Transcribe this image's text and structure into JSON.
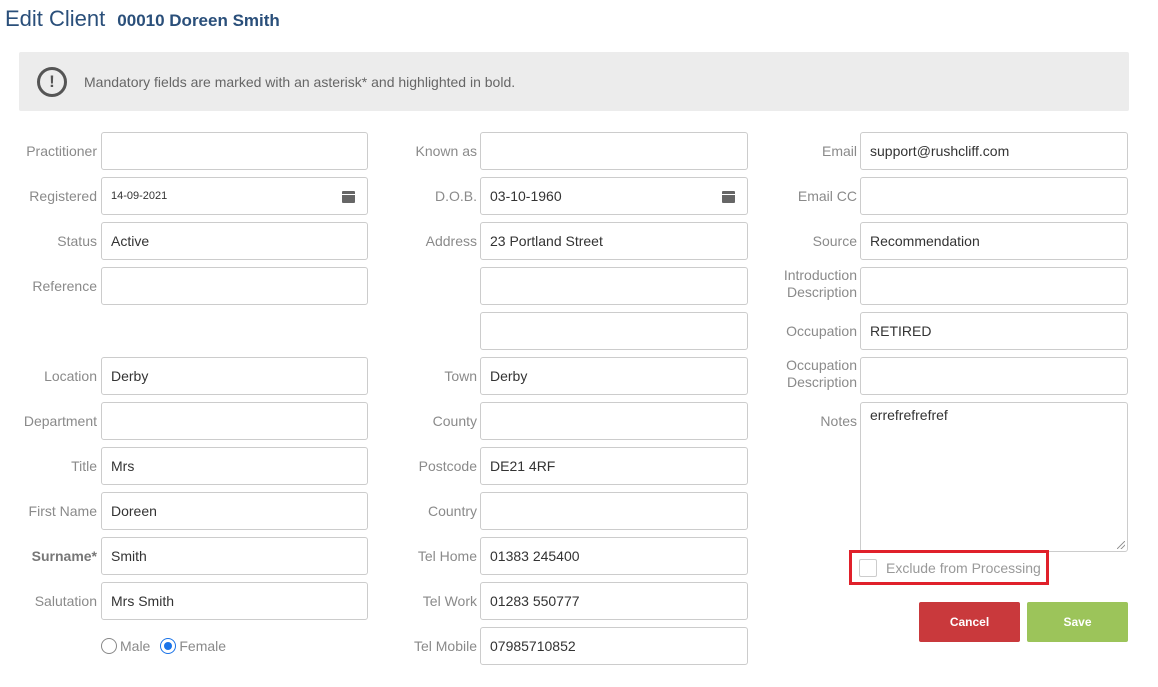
{
  "header": {
    "title": "Edit Client",
    "client": "00010 Doreen Smith"
  },
  "notice": {
    "icon": "info-icon",
    "text": "Mandatory fields are marked with an asterisk* and highlighted in bold."
  },
  "col1": {
    "practitioner": {
      "label": "Practitioner",
      "value": ""
    },
    "registered": {
      "label": "Registered",
      "value": "14-09-2021"
    },
    "status": {
      "label": "Status",
      "value": "Active"
    },
    "reference": {
      "label": "Reference",
      "value": ""
    },
    "location": {
      "label": "Location",
      "value": "Derby"
    },
    "department": {
      "label": "Department",
      "value": ""
    },
    "title": {
      "label": "Title",
      "value": "Mrs"
    },
    "first_name": {
      "label": "First Name",
      "value": "Doreen"
    },
    "surname": {
      "label": "Surname*",
      "value": "Smith"
    },
    "salutation": {
      "label": "Salutation",
      "value": "Mrs Smith"
    },
    "gender": {
      "male": "Male",
      "female": "Female",
      "selected": "Female"
    }
  },
  "col2": {
    "known_as": {
      "label": "Known as",
      "value": ""
    },
    "dob": {
      "label": "D.O.B.",
      "value": "03-10-1960"
    },
    "address": {
      "label": "Address",
      "line1": "23 Portland Street",
      "line2": "",
      "line3": ""
    },
    "town": {
      "label": "Town",
      "value": "Derby"
    },
    "county": {
      "label": "County",
      "value": ""
    },
    "postcode": {
      "label": "Postcode",
      "value": "DE21 4RF"
    },
    "country": {
      "label": "Country",
      "value": ""
    },
    "tel_home": {
      "label": "Tel Home",
      "value": "01383 245400"
    },
    "tel_work": {
      "label": "Tel Work",
      "value": "01283 550777"
    },
    "tel_mobile": {
      "label": "Tel Mobile",
      "value": "07985710852"
    }
  },
  "col3": {
    "email": {
      "label": "Email",
      "value": "support@rushcliff.com"
    },
    "email_cc": {
      "label": "Email CC",
      "value": ""
    },
    "source": {
      "label": "Source",
      "value": "Recommendation"
    },
    "intro_desc": {
      "label1": "Introduction",
      "label2": "Description",
      "value": ""
    },
    "occupation": {
      "label": "Occupation",
      "value": "RETIRED"
    },
    "occ_desc": {
      "label1": "Occupation",
      "label2": "Description",
      "value": ""
    },
    "notes": {
      "label": "Notes",
      "value": "errefrefrefref"
    },
    "exclude": {
      "label": "Exclude from Processing",
      "checked": false
    }
  },
  "buttons": {
    "cancel": "Cancel",
    "save": "Save"
  }
}
